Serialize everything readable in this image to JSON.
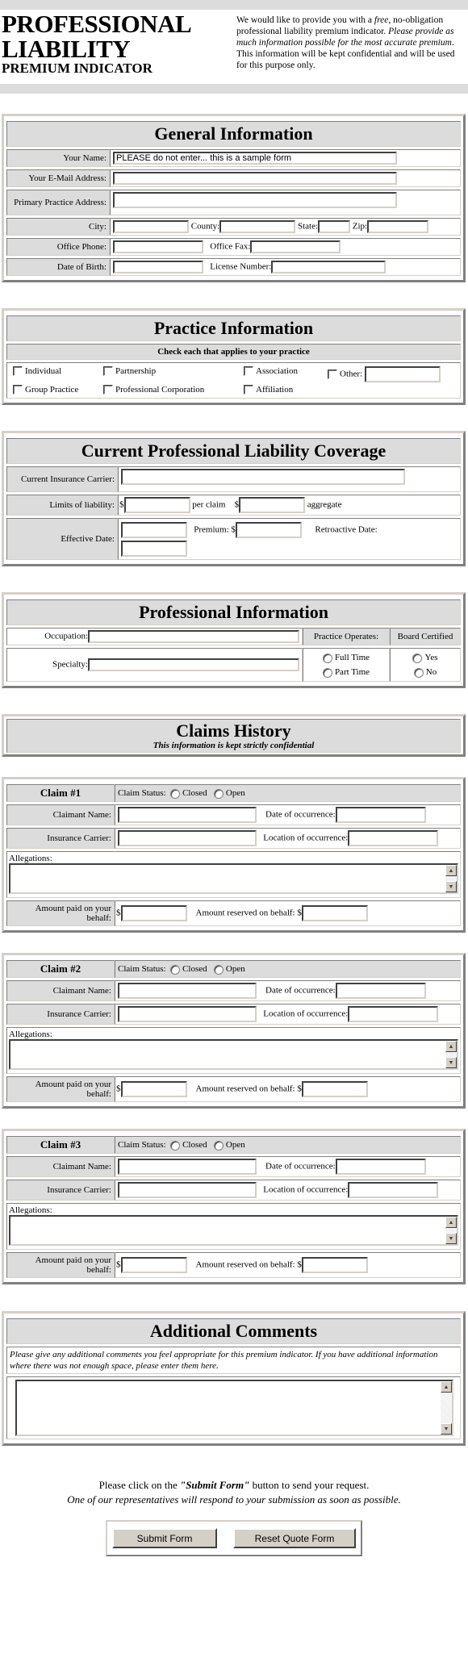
{
  "header": {
    "title_line1": "PROFESSIONAL",
    "title_line2": "LIABILITY",
    "subtitle": "PREMIUM INDICATOR",
    "intro_part1": "We would like to provide you with a ",
    "intro_free": "free",
    "intro_part2": ", no-obligation professional liability premium indicator. ",
    "intro_italic": "Please provide as much information possible for the most accurate premium",
    "intro_part3": ". This information will be kept confidential and will be used for this purpose only."
  },
  "general": {
    "title": "General Information",
    "name_label": "Your Name:",
    "name_value": "PLEASE do not enter... this is a sample form",
    "email_label": "Your E-Mail Address:",
    "address_label": "Primary Practice Address:",
    "city_label": "City:",
    "county_label": "County:",
    "state_label": "State:",
    "zip_label": "Zip:",
    "phone_label": "Office Phone:",
    "fax_label": "Office Fax:",
    "dob_label": "Date of Birth:",
    "license_label": "License Number:"
  },
  "practice": {
    "title": "Practice Information",
    "subtitle": "Check each that applies to your practice",
    "options": [
      "Individual",
      "Partnership",
      "Association",
      "Other:",
      "Group Practice",
      "Professional Corporation",
      "Affiliation"
    ]
  },
  "coverage": {
    "title": "Current Professional Liability Coverage",
    "carrier_label": "Current Insurance Carrier:",
    "limits_label": "Limits of liability:",
    "dollar": "$",
    "per_claim": "per claim",
    "aggregate": "aggregate",
    "effective_label": "Effective Date:",
    "premium_label": "Premium: $",
    "retro_label": "Retroactive Date:"
  },
  "professional": {
    "title": "Professional Information",
    "occupation_label": "Occupation:",
    "specialty_label": "Specialty:",
    "operates_label": "Practice Operates:",
    "operates_options": [
      "Full Time",
      "Part Time"
    ],
    "certified_label": "Board Certified",
    "certified_options": [
      "Yes",
      "No"
    ]
  },
  "claims": {
    "title": "Claims History",
    "subtitle": "This information is kept strictly confidential",
    "status_label": "Claim Status:",
    "status_options": [
      "Closed",
      "Open"
    ],
    "claimant_label": "Claimant Name:",
    "date_label": "Date of occurrence:",
    "carrier_label": "Insurance Carrier:",
    "location_label": "Location of occurrence:",
    "allegations_label": "Allegations:",
    "paid_label": "Amount paid on your behalf:",
    "dollar": "$",
    "reserved_label": "Amount reserved on behalf: $",
    "items": [
      {
        "title": "Claim #1"
      },
      {
        "title": "Claim #2"
      },
      {
        "title": "Claim #3"
      }
    ]
  },
  "comments": {
    "title": "Additional Comments",
    "instructions": "Please give any additional comments you feel appropriate for this premium indicator. If you have additional information where there was not enough space, please enter them here."
  },
  "footer": {
    "line1_a": "Please click on the ",
    "line1_b": "\"Submit Form\"",
    "line1_c": " button to send your request.",
    "line2": "One of our representatives will respond to your submission as soon as possible.",
    "submit_label": "Submit Form",
    "reset_label": "Reset Quote Form"
  }
}
